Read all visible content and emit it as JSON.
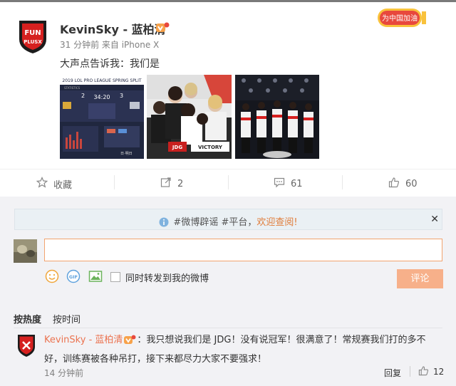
{
  "post": {
    "username": "KevinSky - 蓝柏清",
    "time": "31 分钟前 来自 iPhone X",
    "text": "大声点告诉我：我们是",
    "avatar_text_top": "FUN",
    "avatar_text_bottom": "PLUSX",
    "banner_text": "为中国加油",
    "images": [
      {
        "header": "2019 LOL PRO LEAGUE SPRING SPLIT",
        "sub": "STATISTICS",
        "score_left": "2",
        "score_right": "3",
        "clock": "34:20",
        "footer": "日·明日"
      },
      {
        "tag": "JDG",
        "label": "VICTORY"
      },
      {}
    ]
  },
  "actions": {
    "favorite": "收藏",
    "share": "2",
    "comment": "61",
    "like": "60"
  },
  "notice": {
    "part1": "#微博辟谣",
    "part2": " #平台，",
    "link": "欢迎查阅!"
  },
  "composer": {
    "value": "",
    "repost_label": "同时转发到我的微博",
    "submit_label": "评论"
  },
  "sort": {
    "hot": "按热度",
    "time": "按时间"
  },
  "comment": {
    "name": "KevinSky - 蓝柏清",
    "text": "：我只想说我们是 JDG！没有说冠军！很满意了！常规赛我们打的多不好，训练赛被各种吊打，接下来都尽力大家不要强求！",
    "time": "14 分钟前",
    "reply": "回复",
    "likes": "12"
  },
  "colors": {
    "accent": "#eb7350",
    "submit": "#f7b08a",
    "panel": "#f2f2f5",
    "notice_bg": "#eaf0f4",
    "team_red": "#d6201f"
  }
}
